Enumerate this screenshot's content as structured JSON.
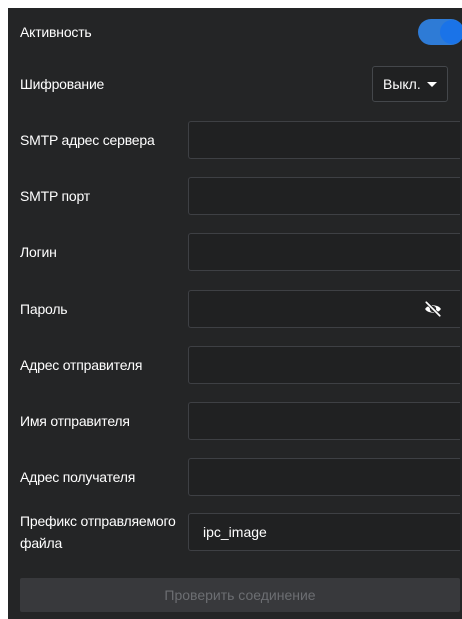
{
  "activity": {
    "label": "Активность",
    "enabled": true
  },
  "encryption": {
    "label": "Шифрование",
    "selected": "Выкл."
  },
  "smtp_server": {
    "label": "SMTP адрес сервера",
    "value": ""
  },
  "smtp_port": {
    "label": "SMTP порт",
    "value": ""
  },
  "login": {
    "label": "Логин",
    "value": ""
  },
  "password": {
    "label": "Пароль",
    "value": "",
    "visibility_icon": "eye-off-icon"
  },
  "sender_address": {
    "label": "Адрес отправителя",
    "value": ""
  },
  "sender_name": {
    "label": "Имя отправителя",
    "value": ""
  },
  "recipient_address": {
    "label": "Адрес получателя",
    "value": ""
  },
  "file_prefix": {
    "label": "Префикс отправляемого файла",
    "value": "ipc_image"
  },
  "check_connection": {
    "label": "Проверить соединение",
    "disabled": true
  },
  "colors": {
    "panel_background": "#242526",
    "field_background": "#202122",
    "toggle_accent": "#1a73e8",
    "disabled_button": "#38393c"
  }
}
